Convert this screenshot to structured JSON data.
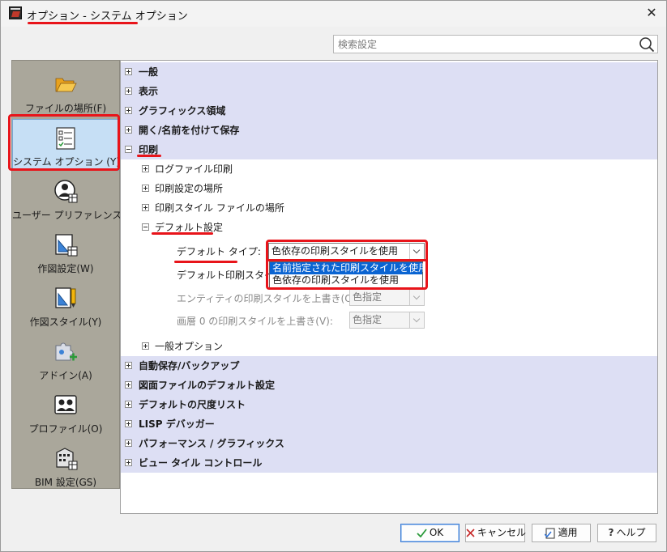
{
  "window": {
    "title": "オプション - システム オプション",
    "close_glyph": "✕",
    "app_icon": "autocad-app-icon"
  },
  "search": {
    "placeholder": "検索設定",
    "icon": "search-icon"
  },
  "sidebar": {
    "items": [
      {
        "label": "ファイルの場所(F)",
        "icon": "folder-icon",
        "active": false
      },
      {
        "label": "システム オプション (Y)",
        "icon": "checklist-icon",
        "active": true
      },
      {
        "label": "ユーザー プリファレンス(U)",
        "icon": "user-preferences-icon",
        "active": false
      },
      {
        "label": "作図設定(W)",
        "icon": "drafting-settings-icon",
        "active": false
      },
      {
        "label": "作図スタイル(Y)",
        "icon": "drafting-style-icon",
        "active": false
      },
      {
        "label": "アドイン(A)",
        "icon": "addin-puzzle-icon",
        "active": false
      },
      {
        "label": "プロファイル(O)",
        "icon": "profile-icon",
        "active": false
      },
      {
        "label": "BIM 設定(GS)",
        "icon": "bim-building-icon",
        "active": false
      }
    ]
  },
  "tree": {
    "general": "一般",
    "display": "表示",
    "graphics": "グラフィックス領域",
    "open_save": "開く/名前を付けて保存",
    "print": "印刷",
    "print_children": {
      "log_file": "ログファイル印刷",
      "print_settings_location": "印刷設定の場所",
      "plot_style_location": "印刷スタイル ファイルの場所",
      "default_settings": "デフォルト設定",
      "general_options": "一般オプション"
    },
    "auto_save": "自動保存/バックアップ",
    "drawing_defaults": "図面ファイルのデフォルト設定",
    "scale_list": "デフォルトの尺度リスト",
    "lisp": "LISP デバッガー",
    "performance": "パフォーマンス / グラフィックス",
    "viewport": "ビュー タイル コントロール"
  },
  "defaults": {
    "type_label": "デフォルト タイプ:",
    "type_value": "色依存の印刷スタイルを使用",
    "plot_style_label": "デフォルト印刷スタイル:",
    "entity_label": "エンティティの印刷スタイルを上書き(O):",
    "entity_value": "色指定",
    "layer_label": "画層 0 の印刷スタイルを上書き(V):",
    "layer_value": "色指定",
    "dropdown_options": [
      "名前指定された印刷スタイルを使用",
      "色依存の印刷スタイルを使用"
    ]
  },
  "buttons": {
    "ok": "OK",
    "cancel": "キャンセル",
    "apply": "適用",
    "help": "ヘルプ"
  },
  "colors": {
    "annotation_red": "#e8141a",
    "selection_blue": "#0a64d2",
    "tree_highlight": "#dddff4"
  }
}
